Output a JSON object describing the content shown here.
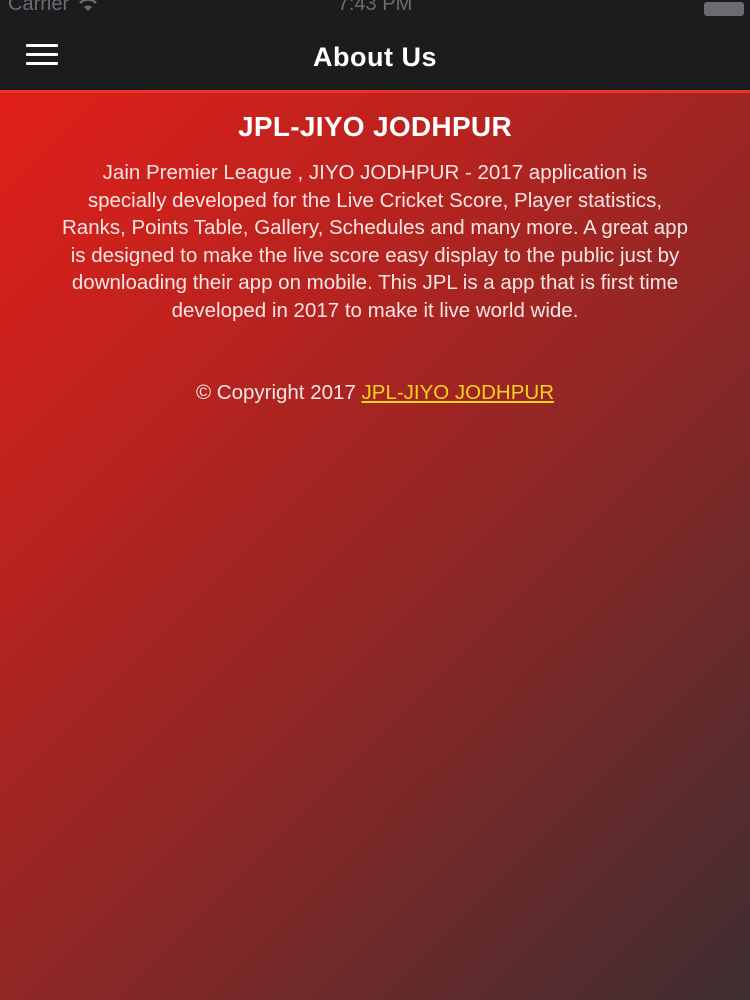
{
  "status_bar": {
    "carrier": "Carrier",
    "time": "7:43 PM",
    "wifi_icon": "wifi-icon",
    "battery_icon": "battery-icon"
  },
  "header": {
    "title": "About Us",
    "menu_icon": "hamburger-menu-icon"
  },
  "main": {
    "heading": "JPL-JIYO JODHPUR",
    "description": "Jain Premier League , JIYO JODHPUR - 2017 application is specially developed for the Live Cricket Score, Player statistics, Ranks, Points Table, Gallery, Schedules and many more. A great app is designed to make the live score easy display to the public just by downloading their app on mobile. This JPL is a app that is first time developed in 2017 to make it live world wide.",
    "copyright_prefix": "© Copyright 2017",
    "copyright_link": "JPL-JIYO JODHPUR"
  },
  "colors": {
    "nav_background": "#1b1c1e",
    "accent_line": "#e8352c",
    "gradient_start": "#e11f1a",
    "gradient_end": "#3e2e31",
    "link": "#f7d21c",
    "text": "#f3e6e4"
  }
}
